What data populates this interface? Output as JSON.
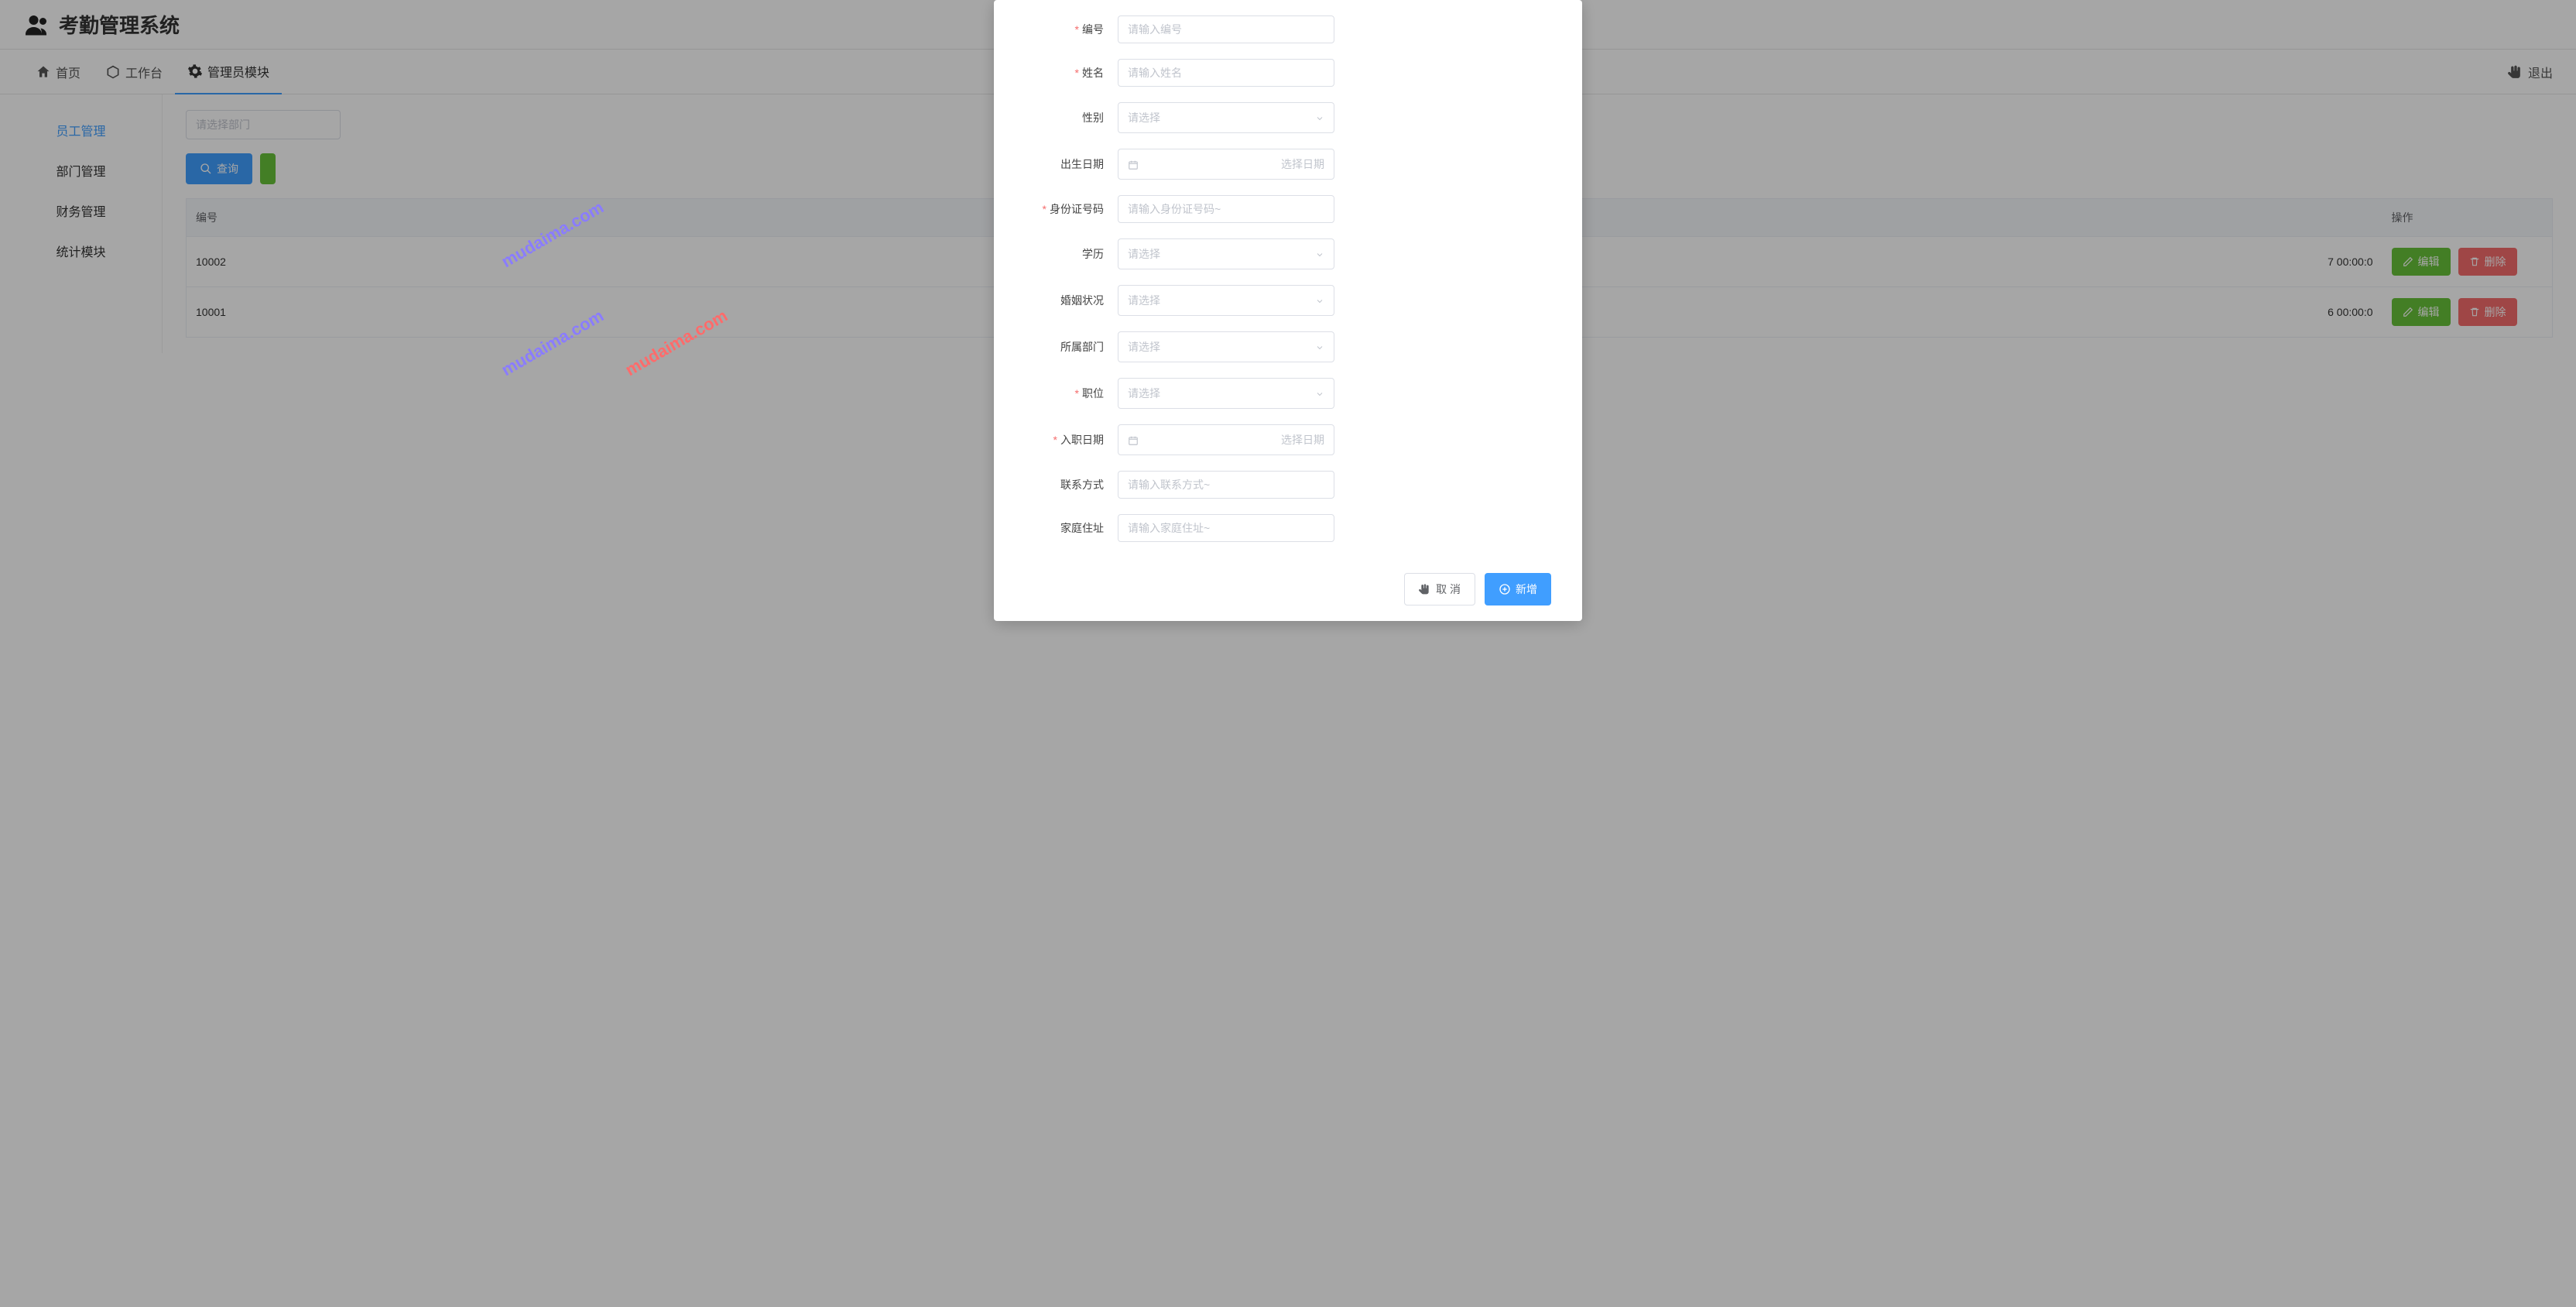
{
  "app": {
    "title": "考勤管理系统"
  },
  "nav": {
    "home": "首页",
    "workspace": "工作台",
    "admin": "管理员模块",
    "logout": "退出"
  },
  "sidebar": {
    "items": [
      {
        "label": "员工管理"
      },
      {
        "label": "部门管理"
      },
      {
        "label": "财务管理"
      },
      {
        "label": "统计模块"
      }
    ]
  },
  "filters": {
    "dept_placeholder": "请选择部门"
  },
  "buttons": {
    "search": "查询",
    "cancel": "取 消",
    "add": "新增",
    "edit": "编辑",
    "delete": "删除"
  },
  "table": {
    "cols": {
      "id": "编号",
      "time": "",
      "action": "操作"
    },
    "rows": [
      {
        "id": "10002",
        "time": "7 00:00:0"
      },
      {
        "id": "10001",
        "time": "6 00:00:0"
      }
    ]
  },
  "form": {
    "fields": {
      "id": {
        "label": "编号",
        "placeholder": "请输入编号",
        "required": true,
        "type": "input"
      },
      "name": {
        "label": "姓名",
        "placeholder": "请输入姓名",
        "required": true,
        "type": "input"
      },
      "gender": {
        "label": "性别",
        "placeholder": "请选择",
        "required": false,
        "type": "select"
      },
      "birth": {
        "label": "出生日期",
        "placeholder": "选择日期",
        "required": false,
        "type": "date"
      },
      "idcard": {
        "label": "身份证号码",
        "placeholder": "请输入身份证号码~",
        "required": true,
        "type": "input"
      },
      "edu": {
        "label": "学历",
        "placeholder": "请选择",
        "required": false,
        "type": "select"
      },
      "marital": {
        "label": "婚姻状况",
        "placeholder": "请选择",
        "required": false,
        "type": "select"
      },
      "dept": {
        "label": "所属部门",
        "placeholder": "请选择",
        "required": false,
        "type": "select"
      },
      "position": {
        "label": "职位",
        "placeholder": "请选择",
        "required": true,
        "type": "select"
      },
      "hiredate": {
        "label": "入职日期",
        "placeholder": "选择日期",
        "required": true,
        "type": "date"
      },
      "contact": {
        "label": "联系方式",
        "placeholder": "请输入联系方式~",
        "required": false,
        "type": "input"
      },
      "address": {
        "label": "家庭住址",
        "placeholder": "请输入家庭住址~",
        "required": false,
        "type": "input"
      }
    }
  },
  "watermark": "mudaima.com"
}
